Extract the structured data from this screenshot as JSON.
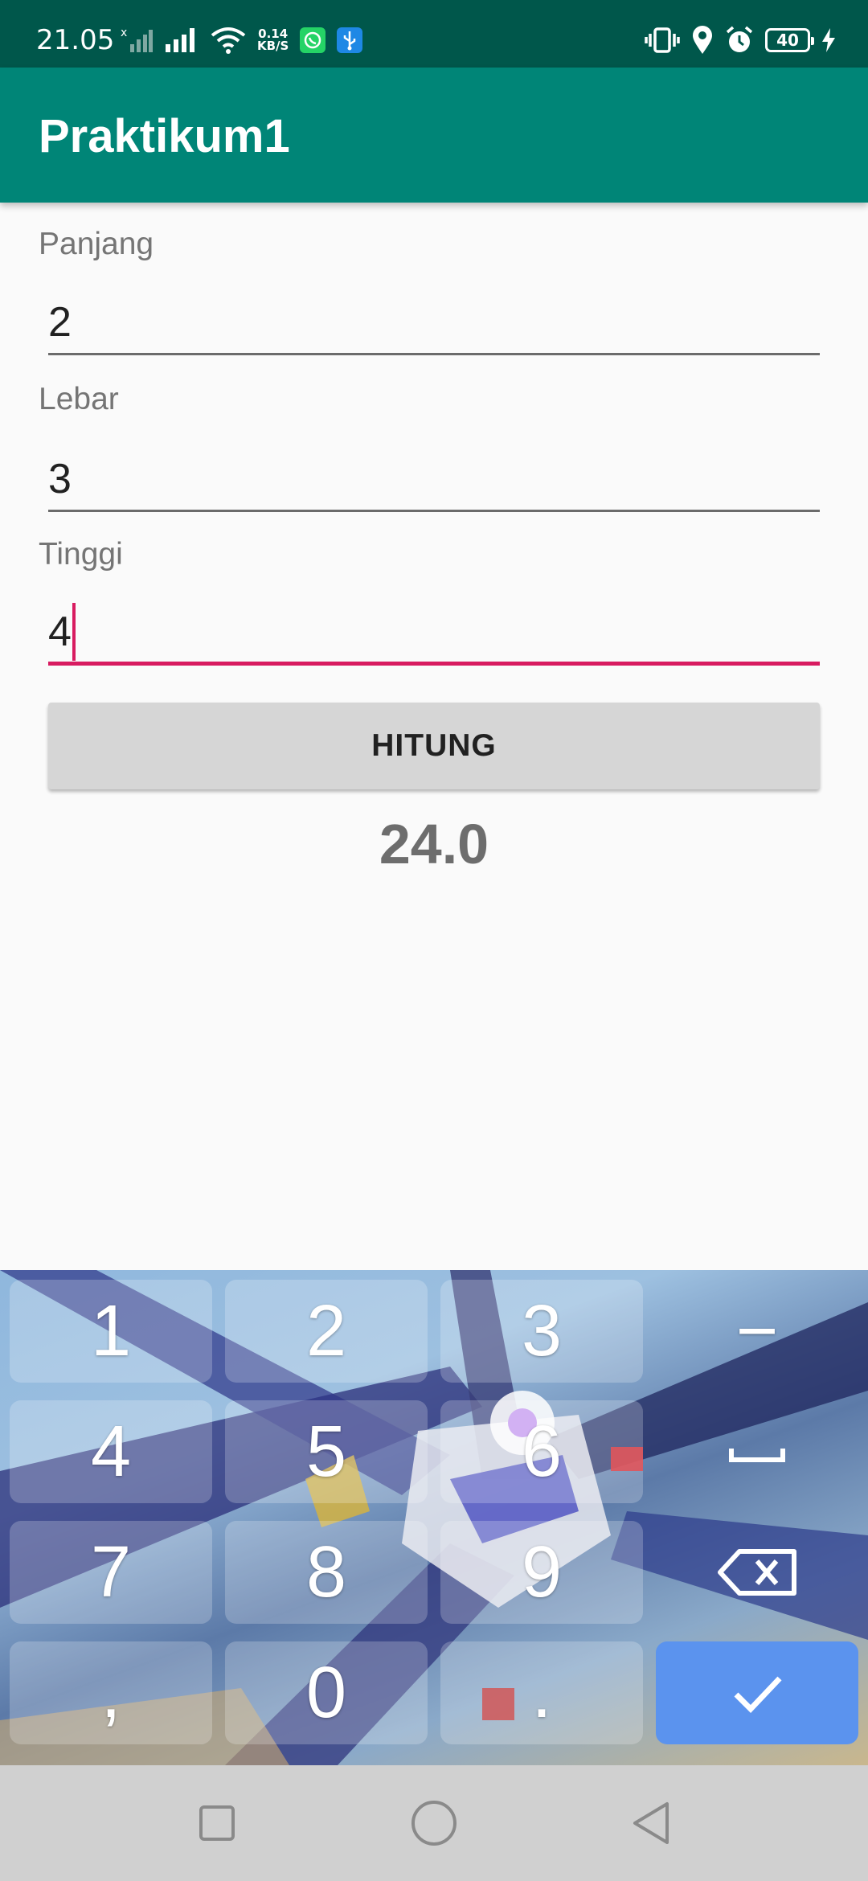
{
  "status_bar": {
    "time": "21.05",
    "speed_value": "0.14",
    "speed_unit": "KB/S",
    "battery": "40"
  },
  "app_bar": {
    "title": "Praktikum1"
  },
  "form": {
    "panjang_label": "Panjang",
    "panjang_value": "2",
    "lebar_label": "Lebar",
    "lebar_value": "3",
    "tinggi_label": "Tinggi",
    "tinggi_value": "4",
    "button_label": "HITUNG",
    "result": "24.0"
  },
  "keyboard": {
    "keys": [
      "1",
      "2",
      "3",
      "−",
      "4",
      "5",
      "6",
      "␣",
      "7",
      "8",
      "9",
      "⌫",
      ",",
      "0",
      ".",
      "✓"
    ]
  },
  "colors": {
    "status_bar": "#00574b",
    "app_bar": "#008577",
    "accent": "#d81b60",
    "done_key": "#5b93ee"
  }
}
